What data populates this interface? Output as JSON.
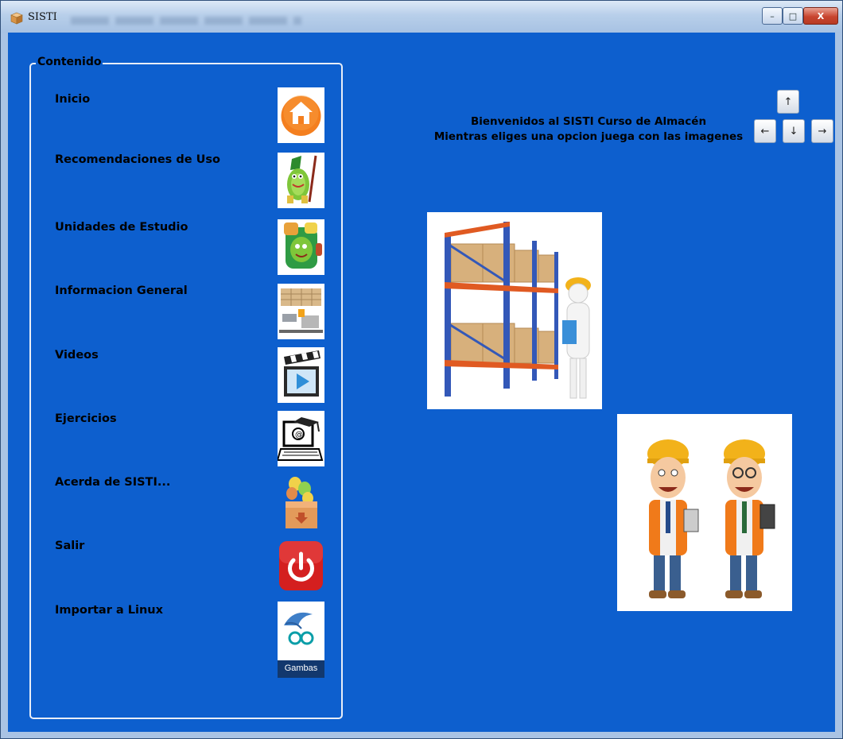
{
  "window": {
    "title": "SISTI",
    "controls": {
      "minimize": "–",
      "maximize": "□",
      "close": "X"
    }
  },
  "sidebar": {
    "group_title": "Contenido",
    "items": [
      {
        "label": "Inicio",
        "icon": "home-icon"
      },
      {
        "label": "Recomendaciones de Uso",
        "icon": "wizard-cartoon-icon"
      },
      {
        "label": "Unidades de Estudio",
        "icon": "backpack-icon"
      },
      {
        "label": "Informacion General",
        "icon": "warehouse-forklift-icon"
      },
      {
        "label": "Videos",
        "icon": "clapperboard-play-icon"
      },
      {
        "label": "Ejercicios",
        "icon": "graduation-computer-icon"
      },
      {
        "label": "Acerda de SISTI...",
        "icon": "box-balloons-icon"
      },
      {
        "label": "Salir",
        "icon": "power-icon"
      },
      {
        "label": "Importar a Linux",
        "icon": "gambas-icon",
        "caption": "Gambas"
      }
    ]
  },
  "main": {
    "welcome_line1": "Bienvenidos al SISTI Curso de Almacén",
    "welcome_line2": "Mientras eliges una opcion juega con las imagenes",
    "arrows": {
      "up": "↑",
      "left": "←",
      "down": "↓",
      "right": "→"
    },
    "images": [
      {
        "name": "warehouse-racks-worker-image"
      },
      {
        "name": "two-workers-image"
      }
    ]
  },
  "colors": {
    "background": "#0d5fce",
    "accent_orange": "#f47f1f",
    "power_red": "#d41f1f"
  }
}
